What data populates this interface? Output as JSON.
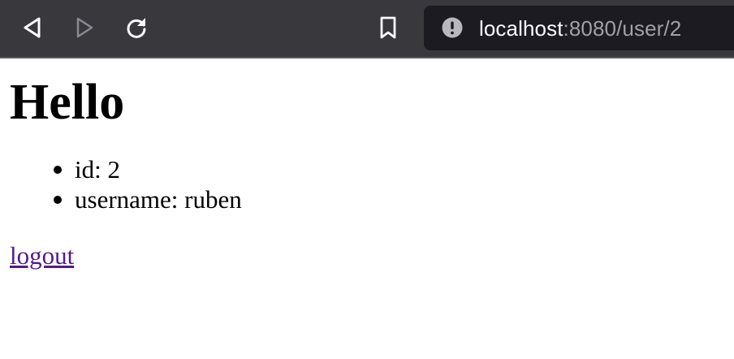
{
  "browser": {
    "url_host": "localhost",
    "url_rest": ":8080/user/2",
    "icons": [
      "back-icon",
      "forward-icon",
      "reload-icon",
      "bookmark-icon",
      "info-icon"
    ]
  },
  "page": {
    "heading": "Hello",
    "details": [
      "id: 2",
      "username: ruben"
    ],
    "logout_link": "logout"
  }
}
